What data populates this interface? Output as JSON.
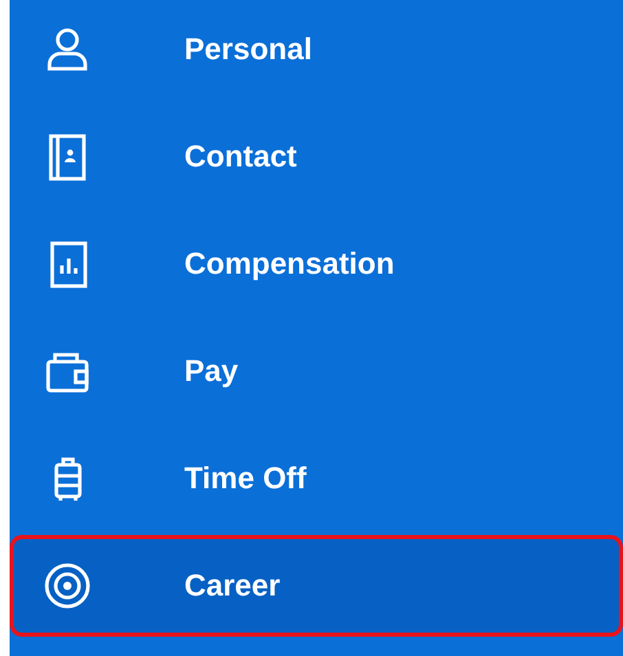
{
  "menu": {
    "items": [
      {
        "label": "Personal",
        "selected": false
      },
      {
        "label": "Contact",
        "selected": false
      },
      {
        "label": "Compensation",
        "selected": false
      },
      {
        "label": "Pay",
        "selected": false
      },
      {
        "label": "Time Off",
        "selected": false
      },
      {
        "label": "Career",
        "selected": true
      }
    ]
  }
}
